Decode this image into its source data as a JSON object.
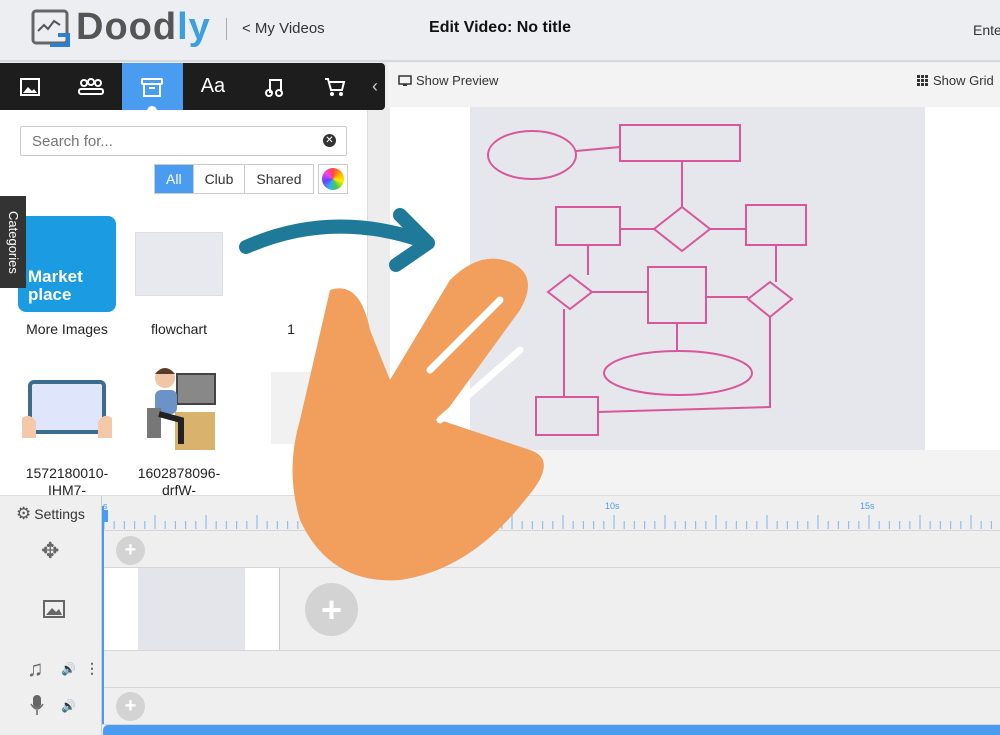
{
  "header": {
    "logo": "Doodly",
    "back_link": "< My Videos",
    "title": "Edit Video: No title",
    "right_text": "Ente"
  },
  "toolbar": {
    "tabs": [
      {
        "icon": "image-icon"
      },
      {
        "icon": "characters-icon"
      },
      {
        "icon": "props-box-icon",
        "active": true
      },
      {
        "icon": "text-icon",
        "label": "Aa"
      },
      {
        "icon": "music-icon"
      },
      {
        "icon": "cart-icon"
      }
    ],
    "collapse": "‹"
  },
  "panel": {
    "search_placeholder": "Search for...",
    "filters": [
      "All",
      "Club",
      "Shared"
    ],
    "active_filter": "All",
    "categories_label": "Categories",
    "items": [
      {
        "label": "More Images",
        "badge": "Market place"
      },
      {
        "label": "flowchart"
      },
      {
        "label": "1"
      },
      {
        "label": "1572180010-IHM7-"
      },
      {
        "label": "1602878096-drfW-"
      },
      {
        "label": ""
      }
    ]
  },
  "preview": {
    "show_preview": "Show Preview",
    "show_grid": "Show Grid"
  },
  "timeline": {
    "settings_label": "Settings",
    "ruler_labels": [
      {
        "t": 0,
        "label": "s"
      },
      {
        "t": 10,
        "label": "10s"
      },
      {
        "t": 15,
        "label": "15s"
      }
    ]
  },
  "colors": {
    "accent": "#4a9cf0",
    "toolbar": "#1d1d1d",
    "hand": "#f29e5c",
    "arrow": "#1f7a9a",
    "sketch": "#d9569a"
  }
}
